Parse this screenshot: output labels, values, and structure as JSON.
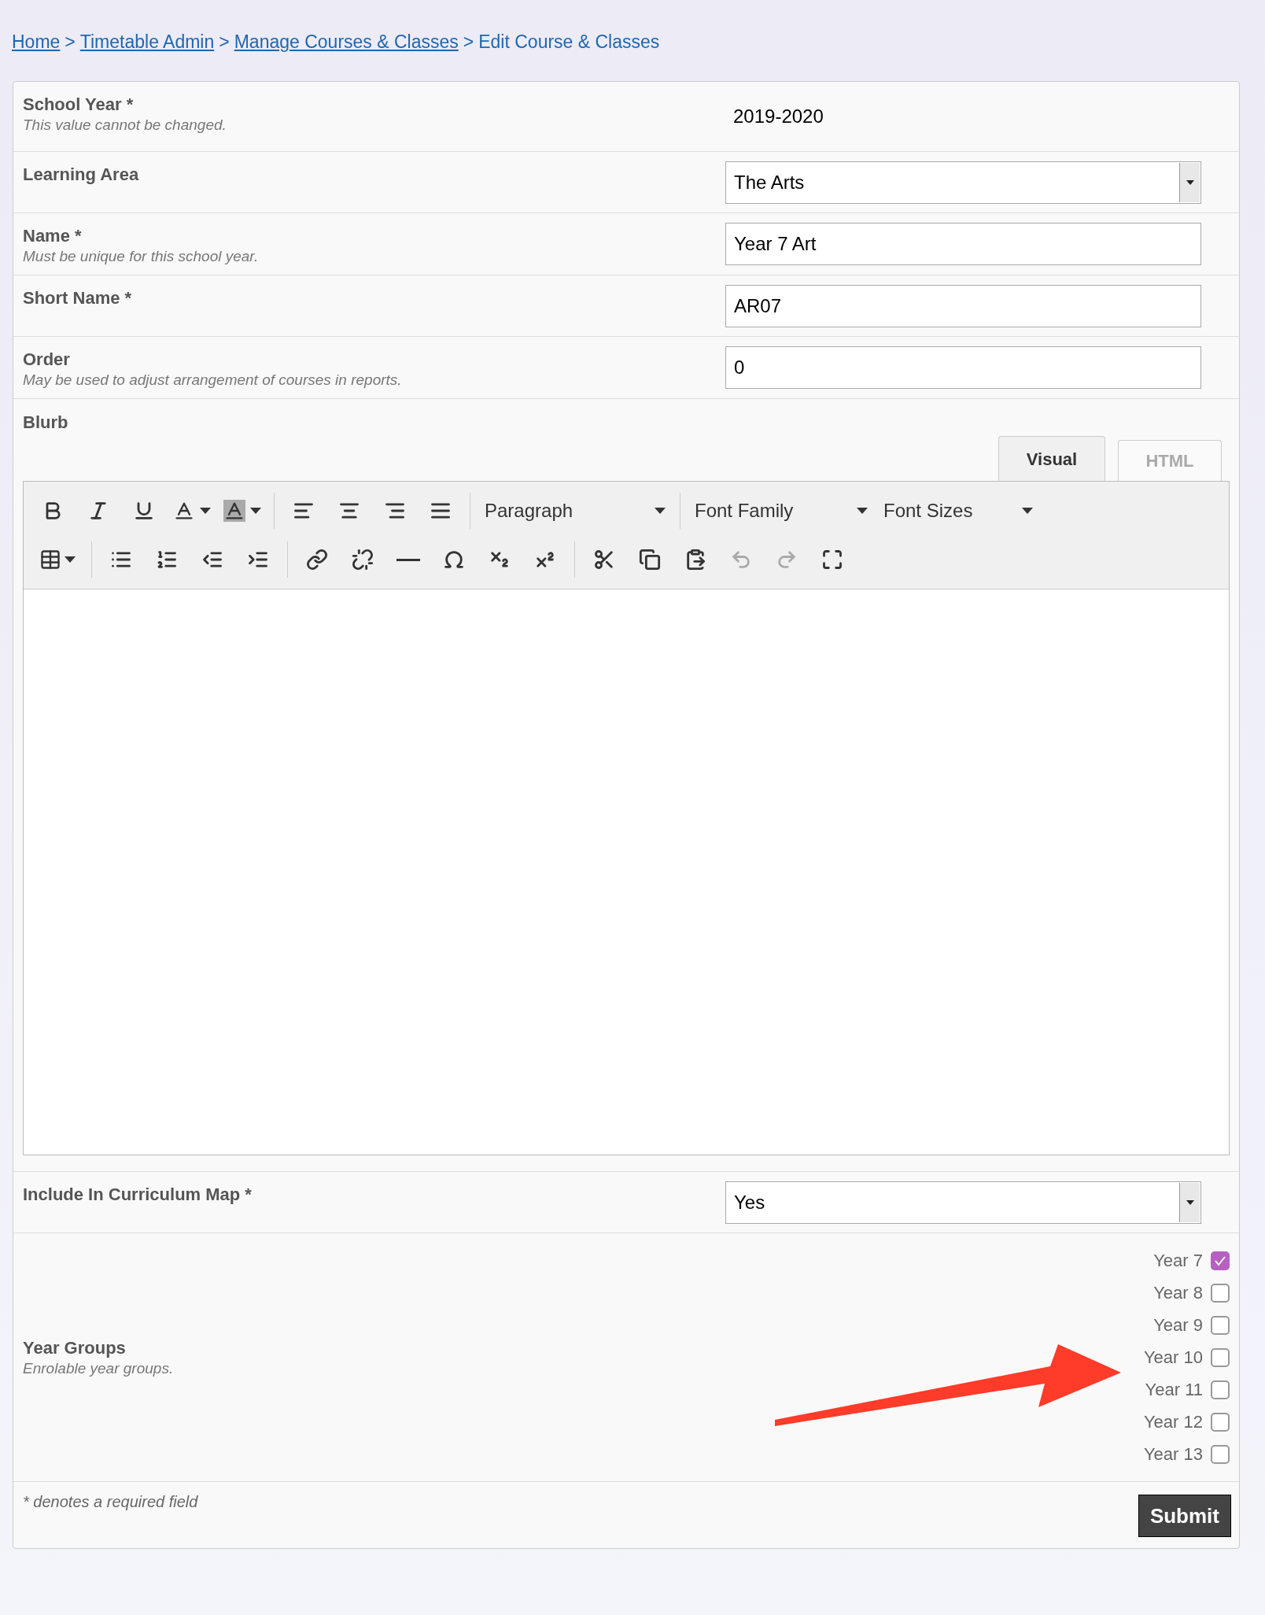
{
  "breadcrumb": [
    {
      "label": "Home",
      "link": true
    },
    {
      "label": "Timetable Admin",
      "link": true
    },
    {
      "label": "Manage Courses & Classes",
      "link": true
    },
    {
      "label": "Edit Course & Classes",
      "link": false
    }
  ],
  "separator": ">",
  "fields": [
    {
      "kind": "static",
      "label": "School Year *",
      "hint": "This value cannot be changed.",
      "value": "2019-2020"
    },
    {
      "kind": "select",
      "label": "Learning Area",
      "value": "The Arts"
    },
    {
      "kind": "text",
      "label": "Name *",
      "hint": "Must be unique for this school year.",
      "value": "Year 7 Art"
    },
    {
      "kind": "text",
      "label": "Short Name *",
      "value": "AR07"
    },
    {
      "kind": "text",
      "label": "Order",
      "hint": "May be used to adjust arrangement of courses in reports.",
      "value": "0"
    },
    {
      "kind": "editor",
      "label": "Blurb"
    },
    {
      "kind": "select",
      "label": "Include In Curriculum Map *",
      "value": "Yes"
    },
    {
      "kind": "checkboxes",
      "label": "Year Groups",
      "hint": "Enrolable year groups."
    }
  ],
  "editor": {
    "tabs": [
      {
        "label": "Visual",
        "selected": true
      },
      {
        "label": "HTML",
        "selected": false
      }
    ],
    "dropdowns": [
      "Paragraph",
      "Font Family",
      "Font Sizes"
    ],
    "undo": {
      "disabled": true
    },
    "redo": {
      "disabled": true
    }
  },
  "year_groups": [
    {
      "label": "Year 7",
      "checked": true
    },
    {
      "label": "Year 8",
      "checked": false
    },
    {
      "label": "Year 9",
      "checked": false
    },
    {
      "label": "Year 10",
      "checked": false
    },
    {
      "label": "Year 11",
      "checked": false
    },
    {
      "label": "Year 12",
      "checked": false
    },
    {
      "label": "Year 13",
      "checked": false
    }
  ],
  "footnote": "* denotes a required field",
  "submit": "Submit",
  "annotations": [
    {
      "kind": "arrow",
      "color": "#ff3b2a"
    }
  ]
}
